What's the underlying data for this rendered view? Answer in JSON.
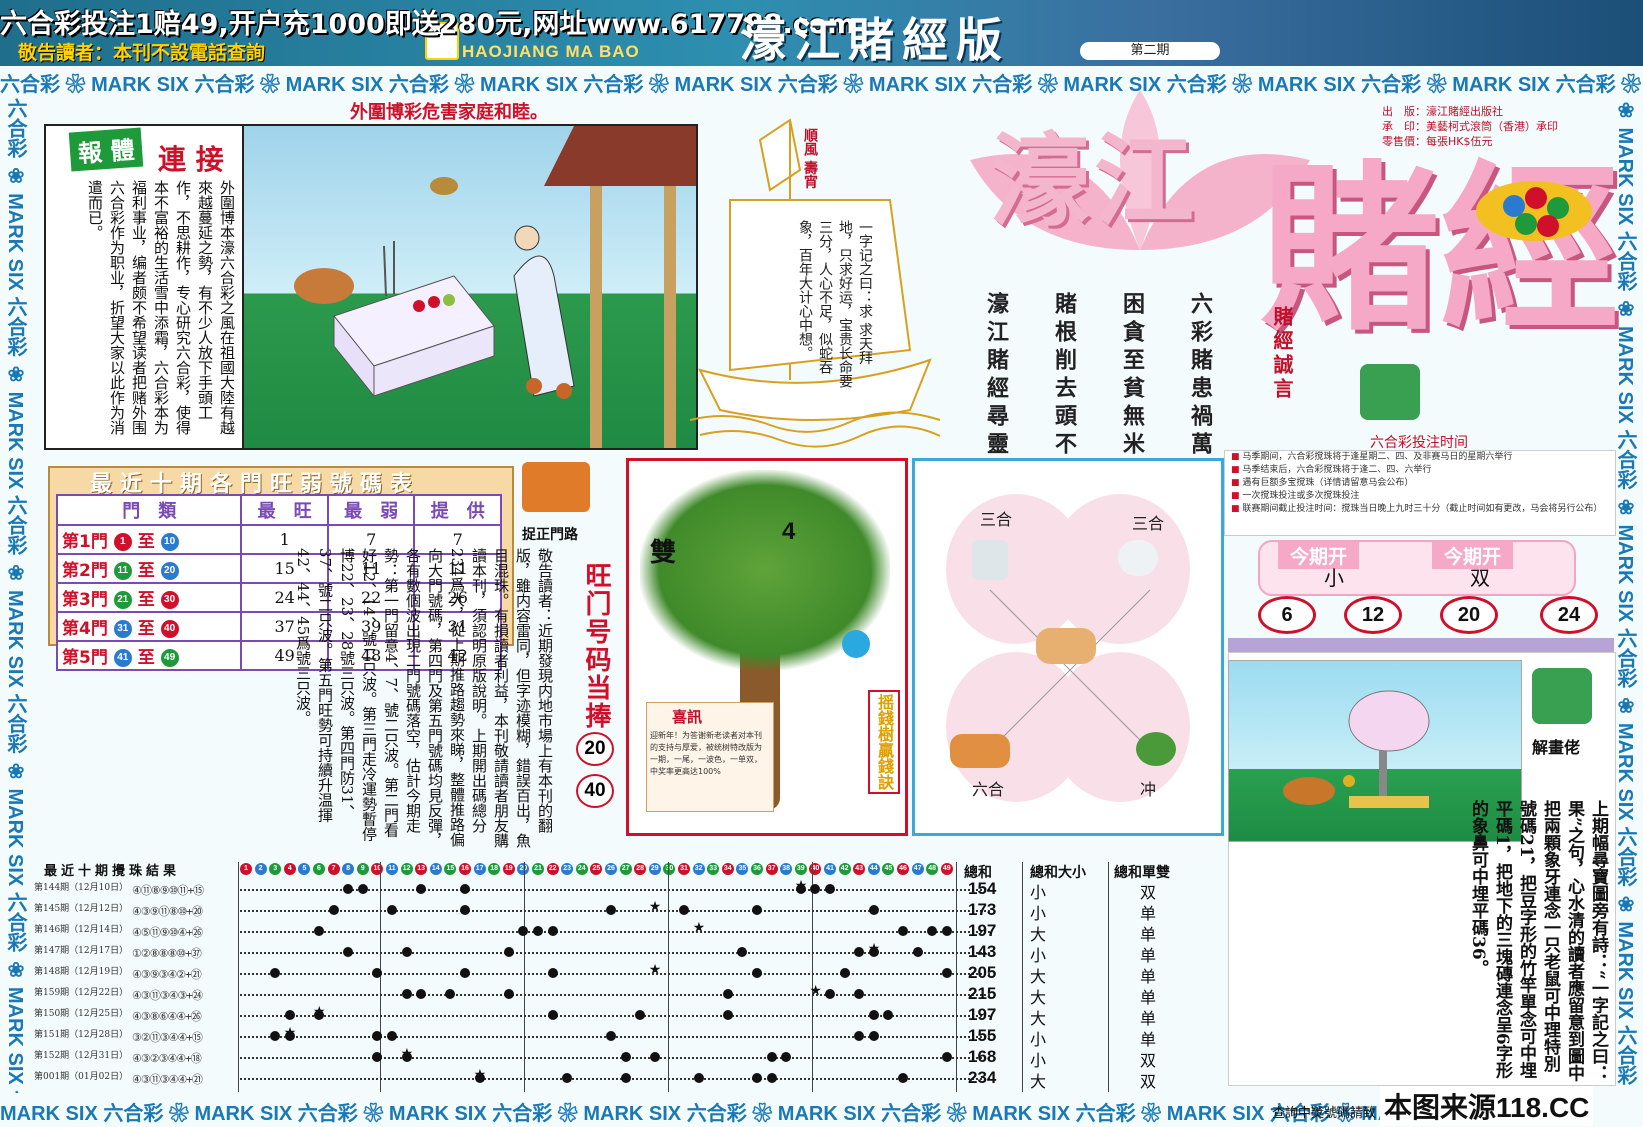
{
  "header": {
    "ad_text": "六合彩投注1赔49,开户充1000即送280元,网址www.617788.com",
    "warning": "敬告讀者：本刊不設電話查詢",
    "logo_en": "HAOJIANG MA BAO",
    "title": "濠江賭經版",
    "issue": "第二期"
  },
  "border": {
    "top": "六合彩 ❀ MARK SIX 六合彩 ❀ MARK SIX 六合彩 ❀ MARK SIX 六合彩 ❀ MARK SIX 六合彩 ❀ MARK SIX 六合彩 ❀ MARK SIX 六合彩 ❀ MARK SIX 六合彩 ❀ MARK SIX 六合彩 ❀ MARK SIX 六合彩 ❀ MARK SIX",
    "bottom": "MARK SIX 六合彩 ❀ MARK SIX 六合彩 ❀ MARK SIX 六合彩 ❀ MARK SIX 六合彩 ❀ MARK SIX 六合彩 ❀ MARK SIX 六合彩 ❀ MARK SIX 六合彩 ❀ MA",
    "left": "六合彩 ❀ MARK SIX 六合彩 ❀ MARK SIX 六合彩 ❀ MARK SIX 六合彩 ❀ MARK SIX 六合彩 ❀ MARK SIX 六合彩 ❀ MARK SIX",
    "right": "❀ MARK SIX 六合彩 ❀ MARK SIX 六合彩 ❀ MARK SIX 六合彩 ❀ MARK SIX 六合彩 ❀ MARK SIX 六合彩 ❀ MARK SIX 六合彩"
  },
  "slogan": "外圍博彩危害家庭和睦。",
  "report": {
    "label_green": "報 體",
    "label_red": "連 接",
    "text": "外圍博本濠六合彩之風在祖國大陸有越來越蔓延之勢，有不少人放下手頭工作，不思耕作，专心研究六合彩，使得本不富裕的生活雪中添霜，六合彩本为福利事业，编者颇不希望读者把赌外围六合彩作为职业，折望大家以此作为消遣而已。"
  },
  "boat": {
    "flag": "順風 壽宵",
    "poem": "一字记之曰：求 求天拜地，只求好运，宝贵长命要三分，人心不足，似蛇吞象，百年大计心中想。"
  },
  "publisher": {
    "line1": "出　版：濠江賭經出版社",
    "line2": "承　印：美藝柯式滾筒（香港）承印",
    "line3": "零售價：每張HK$伍元"
  },
  "main_title": {
    "top": "濠江",
    "bottom": "賭經"
  },
  "poem_cols": [
    "六彩賭患禍萬家",
    "困貪至貧無米炊",
    "賭根削去頭不回",
    "濠江賭經尋靈碼"
  ],
  "motto": "賭經誠言",
  "bet_time": {
    "title": "六合彩投注时间",
    "notes": [
      "马季期间，六合彩搅珠将于逢星期二、四、及非赛马日的星期六举行",
      "马季结束后，六合彩搅珠将于逢二、四、六举行",
      "遇有巨额多宝搅珠（详情请留意马会公布）",
      "一次搅珠投注或多次搅珠投注",
      "联赛期间截止投注时间：搅珠当日晚上九时三十分（截止时间如有更改，马会将另行公布）"
    ]
  },
  "open_result": {
    "label1": "今期开",
    "label2": "今期开",
    "value1": "小",
    "value2": "双",
    "balls": [
      "6",
      "12",
      "20",
      "24"
    ]
  },
  "stats_table": {
    "title": "最近十期各門旺弱號碼表",
    "headers": [
      "門　類",
      "最　旺",
      "最　弱",
      "提　供"
    ],
    "rows": [
      {
        "gate": "第1門",
        "from": "1",
        "to": "10",
        "hot": "1",
        "weak": "7",
        "tip": "7",
        "c1": "#d0102a",
        "c2": "#2a7bd0"
      },
      {
        "gate": "第2門",
        "from": "11",
        "to": "20",
        "hot": "15",
        "weak": "11",
        "tip": "11",
        "c1": "#1e9a3a",
        "c2": "#2a7bd0"
      },
      {
        "gate": "第3門",
        "from": "21",
        "to": "30",
        "hot": "24",
        "weak": "22",
        "tip": "26",
        "c1": "#1e9a3a",
        "c2": "#d0102a"
      },
      {
        "gate": "第4門",
        "from": "31",
        "to": "40",
        "hot": "37",
        "weak": "39",
        "tip": "31",
        "c1": "#2a7bd0",
        "c2": "#d0102a"
      },
      {
        "gate": "第5門",
        "from": "41",
        "to": "49",
        "hot": "49",
        "weak": "48",
        "tip": "42",
        "c1": "#2a7bd0",
        "c2": "#1e9a3a"
      }
    ]
  },
  "gate_label": "捉正門路",
  "notice_text": "敬告讀者：近期發現内地市場上有本刊的翻版，雖内容雷同，但字迹模糊，錯誤百出，魚目混珠。有損讀者利益，本刊敬請讀者朋友購讀本刊，須認明原版說明。上期開出碼總分234爲大，從上期推路趨勢來睇，整體推路偏向大門號碼，第四門及第五門號碼均見反彈，各有數個波出現二門號碼落空，估計今期走勢：第一門留意4、7、號二只波。第二門看好12、14、號二只波。第三門走冷運勢暫停博22、23、28號三只波。第四門防31、37、號二只波。第五門旺勢可持續升温揮42、44、45爲號三只波。",
  "hot_gate": {
    "label": "旺门号码当捧",
    "balls": [
      "20",
      "40"
    ]
  },
  "tree": {
    "left_char": "雙",
    "right_char": "4",
    "side": "摇錢樹贏錢訣",
    "news_title": "喜訊",
    "news_text": "迎新年！为答谢新老读者对本刊的支持与厚爱，被统树特改版为一期，一尾，一波色，一单双，中奖率更高达100%"
  },
  "zodiac": {
    "tl": "三合",
    "tr": "三合",
    "bl": "六合",
    "br": "冲"
  },
  "explain": {
    "label": "解畫佬",
    "text": "上期幅尋寶圖旁有詩：“一字記之曰：果”之句，心水清的讀者應留意到圖中把兩顆象牙連念一只老鼠可中理特別號碼21，把豆字形的竹竿單念可中埋平碼1，把地下的三塊磚連念呈6字形的象鼻可中埋平碼36。"
  },
  "results": {
    "title": "最近十期攪珠結果",
    "header_balls_count": 49,
    "col_sum": "總和",
    "col_bs": "總和大小",
    "col_oe": "總和單雙",
    "rows": [
      {
        "label": "第144期（12月10日）",
        "balls": "④⑪⑧⑨⑩⑪+⑮",
        "sum": "154",
        "bs": "小",
        "oe": "双",
        "dots": [
          8,
          39,
          40,
          41,
          9,
          13,
          16
        ],
        "star": 39
      },
      {
        "label": "第145期（12月12日）",
        "balls": "④③⑨⑪⑧⑩+⑳",
        "sum": "173",
        "bs": "小",
        "oe": "单",
        "dots": [
          7,
          11,
          16,
          26,
          31,
          36,
          44
        ],
        "star": 29
      },
      {
        "label": "第146期（12月14日）",
        "balls": "④⑤⑪⑨⑩④+㉖",
        "sum": "197",
        "bs": "大",
        "oe": "单",
        "dots": [
          6,
          20,
          21,
          22,
          46,
          48,
          49
        ],
        "star": 32
      },
      {
        "label": "第147期（12月17日）",
        "balls": "①②⑧⑧⑧⑩+㊲",
        "sum": "143",
        "bs": "小",
        "oe": "单",
        "dots": [
          8,
          12,
          19,
          35,
          43,
          44,
          47
        ],
        "star": 44
      },
      {
        "label": "第148期（12月19日）",
        "balls": "④③⑨③④②+㉑",
        "sum": "205",
        "bs": "大",
        "oe": "单",
        "dots": [
          3,
          10,
          16,
          22,
          36,
          42,
          49
        ],
        "star": 29
      },
      {
        "label": "第159期（12月22日）",
        "balls": "④③⑪③④③+㉔",
        "sum": "215",
        "bs": "大",
        "oe": "单",
        "dots": [
          12,
          13,
          15,
          19,
          34,
          41,
          43
        ],
        "star": 40
      },
      {
        "label": "第150期（12月25日）",
        "balls": "④③⑧⑥④④+㉖",
        "sum": "197",
        "bs": "大",
        "oe": "单",
        "dots": [
          4,
          6,
          22,
          28,
          34,
          44,
          45
        ],
        "star": 6
      },
      {
        "label": "第151期（12月28日）",
        "balls": "③②⑪③④④+⑮",
        "sum": "155",
        "bs": "小",
        "oe": "单",
        "dots": [
          3,
          4,
          10,
          11,
          26,
          43,
          44
        ],
        "star": 4
      },
      {
        "label": "第152期（12月31日）",
        "balls": "④③②③④④+⑱",
        "sum": "168",
        "bs": "小",
        "oe": "双",
        "dots": [
          10,
          12,
          27,
          29,
          37,
          38,
          49
        ],
        "star": 12
      },
      {
        "label": "第001期（01月02日）",
        "balls": "④③⑪③④④+㉑",
        "sum": "234",
        "bs": "大",
        "oe": "双",
        "dots": [
          17,
          23,
          27,
          32,
          36,
          37,
          46
        ],
        "star": 17
      }
    ]
  },
  "footer": {
    "source": "本图来源118.CC",
    "query": "查詢中獎號碼請致"
  },
  "colors": {
    "red": "#d0102a",
    "blue": "#1a78b5",
    "green": "#1e9a3a",
    "pink": "#f5a9c6"
  }
}
